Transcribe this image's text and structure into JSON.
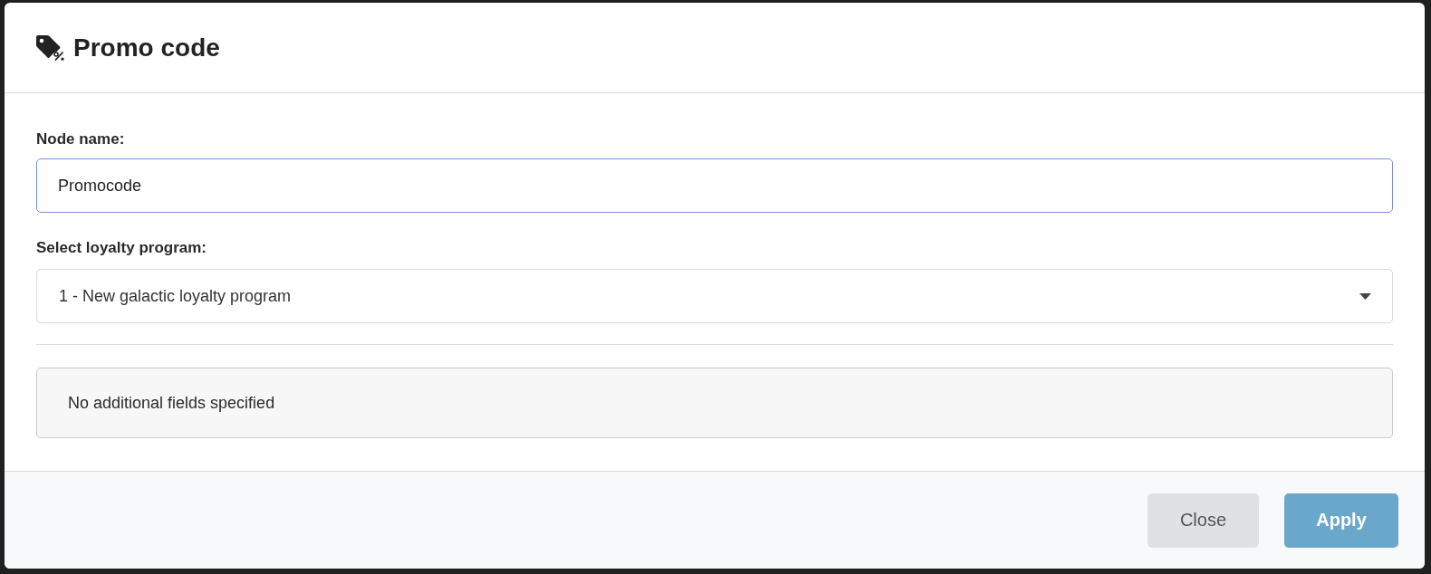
{
  "dialog": {
    "title": "Promo code",
    "fields": [
      {
        "kind": "text",
        "label": "Node name:",
        "value": "Promocode",
        "focused": true
      },
      {
        "kind": "select",
        "label": "Select loyalty program:",
        "value": "1 - New galactic loyalty program",
        "focused": false
      }
    ],
    "notice": "No additional fields specified",
    "buttons": [
      {
        "label": "Close",
        "kind": "secondary"
      },
      {
        "label": "Apply",
        "kind": "primary"
      }
    ]
  }
}
